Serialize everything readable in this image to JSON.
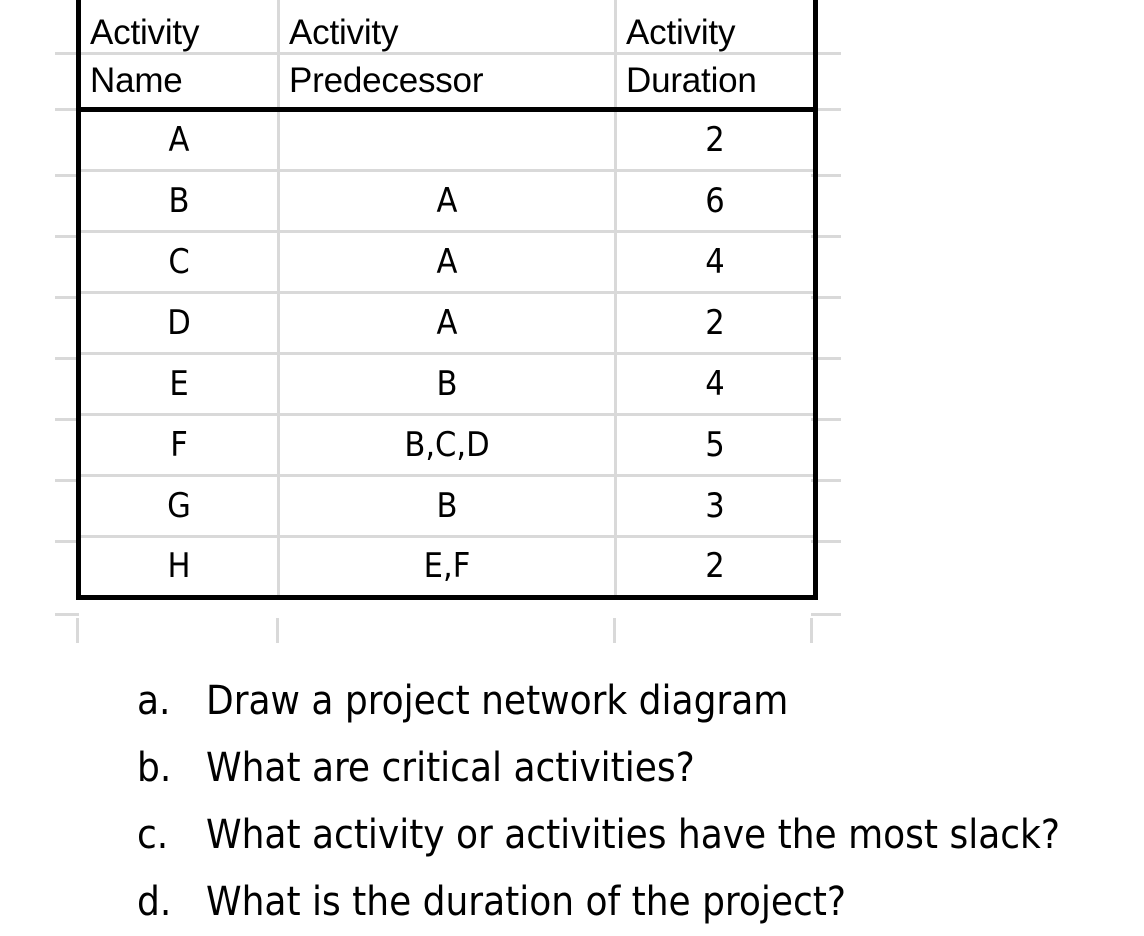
{
  "table": {
    "headers": [
      {
        "top": "Activity",
        "bottom": "Name"
      },
      {
        "top": "Activity",
        "bottom": "Predecessor"
      },
      {
        "top": "Activity",
        "bottom": "Duration"
      }
    ],
    "rows": [
      {
        "name": "A",
        "predecessor": "",
        "duration": "2"
      },
      {
        "name": "B",
        "predecessor": "A",
        "duration": "6"
      },
      {
        "name": "C",
        "predecessor": "A",
        "duration": "4"
      },
      {
        "name": "D",
        "predecessor": "A",
        "duration": "2"
      },
      {
        "name": "E",
        "predecessor": "B",
        "duration": "4"
      },
      {
        "name": "F",
        "predecessor": "B,C,D",
        "duration": "5"
      },
      {
        "name": "G",
        "predecessor": "B",
        "duration": "3"
      },
      {
        "name": "H",
        "predecessor": "E,F",
        "duration": "2"
      }
    ]
  },
  "questions": [
    {
      "marker": "a.",
      "text": "Draw a project network diagram"
    },
    {
      "marker": "b.",
      "text": "What are critical activities?"
    },
    {
      "marker": "c.",
      "text": "What activity or activities have the most slack?"
    },
    {
      "marker": "d.",
      "text": "What is the duration of the project?"
    }
  ],
  "colors": {
    "gridline": "#d9d9d9",
    "border": "#000000",
    "text": "#000000",
    "background": "#ffffff"
  }
}
